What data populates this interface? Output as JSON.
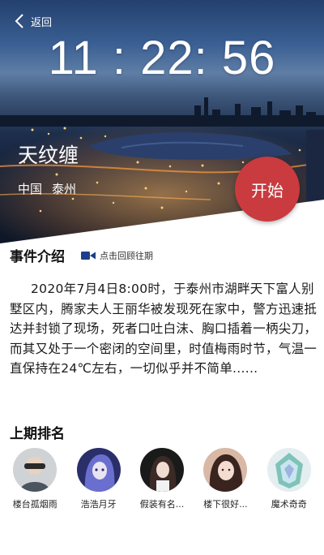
{
  "header": {
    "back_label": "返回",
    "clock": "11 : 22: 56"
  },
  "event": {
    "title": "天纹缠",
    "country": "中国",
    "city": "泰州",
    "start_label": "开始"
  },
  "intro": {
    "heading": "事件介绍",
    "replay_label": "点击回顾往期",
    "description": "2020年7月4日8:00时，于泰州市湖畔天下富人别墅区内，腾家夫人王丽华被发现死在家中，警方迅速抵达并封锁了现场，死者口吐白沫、胸口插着一柄尖刀，而其又处于一个密闭的空间里，时值梅雨时节，气温一直保持在24℃左右，一切似乎并不简单......"
  },
  "ranking": {
    "heading": "上期排名",
    "players": [
      {
        "name": "楼台孤烟雨"
      },
      {
        "name": "浩浩月牙"
      },
      {
        "name": "假装有名..."
      },
      {
        "name": "楼下很好..."
      },
      {
        "name": "魔术奇奇"
      }
    ]
  },
  "colors": {
    "accent": "#c93b3f",
    "video_icon": "#1d3f8a"
  }
}
